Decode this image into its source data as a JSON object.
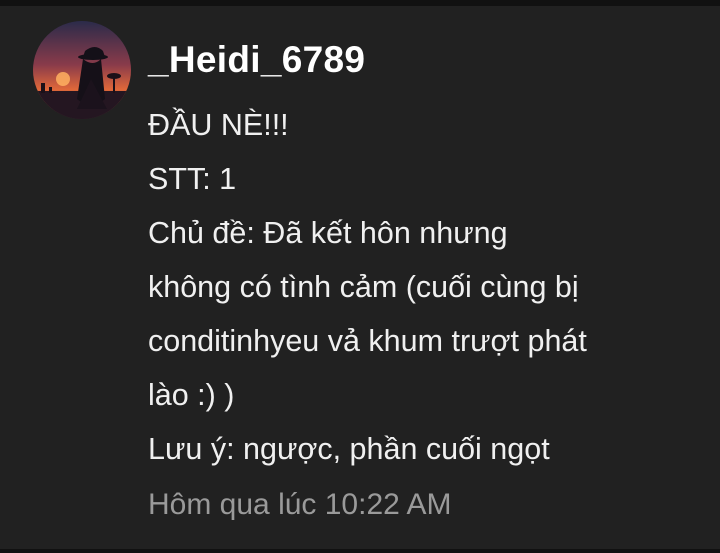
{
  "message": {
    "author": "_Heidi_6789",
    "avatar_icon": "user-avatar-sunset-silhouette",
    "lines": [
      "ĐẦU NÈ!!!",
      "STT: 1",
      "Chủ đề: Đã kết hôn nhưng",
      "không có tình cảm (cuối cùng bị",
      "conditinhyeu vả khum trượt phát",
      "lào :) )",
      "Lưu ý: ngược, phần cuối ngọt"
    ],
    "timestamp": "Hôm qua lúc 10:22 AM"
  },
  "colors": {
    "background": "#212121",
    "text": "#f0f0f0",
    "timestamp": "#9a9a9a"
  }
}
